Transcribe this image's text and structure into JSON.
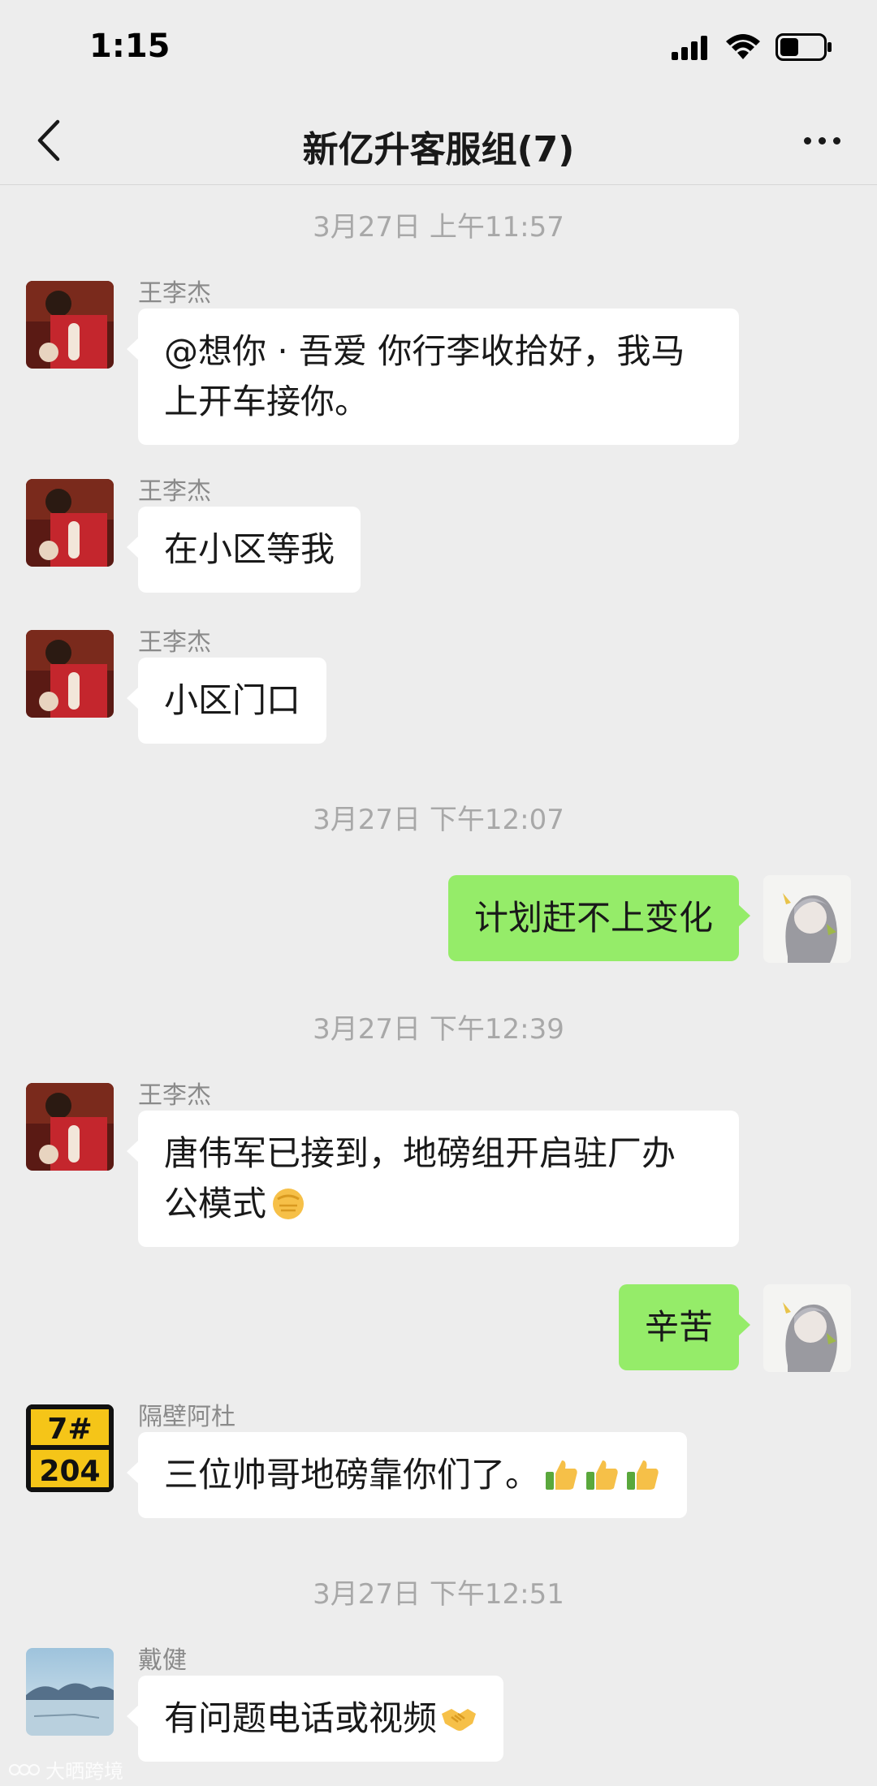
{
  "status_bar": {
    "time": "1:15"
  },
  "header": {
    "title": "新亿升客服组(7)"
  },
  "messages": [
    {
      "type": "timestamp",
      "text": "3月27日 上午11:57"
    },
    {
      "type": "incoming",
      "sender": "王李杰",
      "text_lines": [
        "@想你 · 吾爱 你行李收拾好，我马",
        "上开车接你。"
      ]
    },
    {
      "type": "incoming",
      "sender": "王李杰",
      "text": "在小区等我"
    },
    {
      "type": "incoming",
      "sender": "王李杰",
      "text": "小区门口"
    },
    {
      "type": "timestamp",
      "text": "3月27日 下午12:07"
    },
    {
      "type": "outgoing",
      "text": "计划赶不上变化"
    },
    {
      "type": "timestamp",
      "text": "3月27日 下午12:39"
    },
    {
      "type": "incoming",
      "sender": "王李杰",
      "text_lines": [
        "唐伟军已接到，地磅组开启驻厂办",
        "公模式"
      ],
      "emoji": "fist-emoji"
    },
    {
      "type": "outgoing",
      "text": "辛苦"
    },
    {
      "type": "incoming",
      "sender": "隔壁阿杜",
      "text": "三位帅哥地磅靠你们了。",
      "emoji": "thumbs-up-emoji x3",
      "avatar_text": [
        "7#",
        "204"
      ]
    },
    {
      "type": "timestamp",
      "text": "3月27日 下午12:51"
    },
    {
      "type": "incoming",
      "sender": "戴健",
      "text": "有问题电话或视频",
      "emoji": "handshake-emoji"
    }
  ],
  "watermark": {
    "text": "大晒跨境"
  },
  "colors": {
    "background": "#ededed",
    "incoming_bubble": "#ffffff",
    "outgoing_bubble": "#95ec69",
    "timestamp": "#a8a8a8"
  }
}
